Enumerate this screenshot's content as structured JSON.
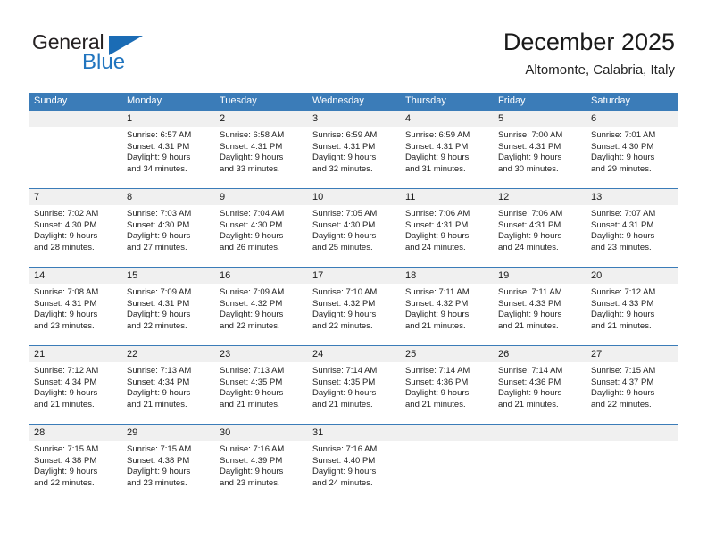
{
  "brand": {
    "name_part1": "General",
    "name_part2": "Blue",
    "flag_icon": "blue-triangle-flag",
    "accent_color": "#2175bf"
  },
  "header": {
    "title": "December 2025",
    "subtitle": "Altomonte, Calabria, Italy"
  },
  "calendar": {
    "header_bg": "#3b7cb8",
    "daynum_bg": "#f0f0f0",
    "weekdays": [
      "Sunday",
      "Monday",
      "Tuesday",
      "Wednesday",
      "Thursday",
      "Friday",
      "Saturday"
    ],
    "weeks": [
      [
        {
          "day": "",
          "sunrise": "",
          "sunset": "",
          "daylight1": "",
          "daylight2": ""
        },
        {
          "day": "1",
          "sunrise": "Sunrise: 6:57 AM",
          "sunset": "Sunset: 4:31 PM",
          "daylight1": "Daylight: 9 hours",
          "daylight2": "and 34 minutes."
        },
        {
          "day": "2",
          "sunrise": "Sunrise: 6:58 AM",
          "sunset": "Sunset: 4:31 PM",
          "daylight1": "Daylight: 9 hours",
          "daylight2": "and 33 minutes."
        },
        {
          "day": "3",
          "sunrise": "Sunrise: 6:59 AM",
          "sunset": "Sunset: 4:31 PM",
          "daylight1": "Daylight: 9 hours",
          "daylight2": "and 32 minutes."
        },
        {
          "day": "4",
          "sunrise": "Sunrise: 6:59 AM",
          "sunset": "Sunset: 4:31 PM",
          "daylight1": "Daylight: 9 hours",
          "daylight2": "and 31 minutes."
        },
        {
          "day": "5",
          "sunrise": "Sunrise: 7:00 AM",
          "sunset": "Sunset: 4:31 PM",
          "daylight1": "Daylight: 9 hours",
          "daylight2": "and 30 minutes."
        },
        {
          "day": "6",
          "sunrise": "Sunrise: 7:01 AM",
          "sunset": "Sunset: 4:30 PM",
          "daylight1": "Daylight: 9 hours",
          "daylight2": "and 29 minutes."
        }
      ],
      [
        {
          "day": "7",
          "sunrise": "Sunrise: 7:02 AM",
          "sunset": "Sunset: 4:30 PM",
          "daylight1": "Daylight: 9 hours",
          "daylight2": "and 28 minutes."
        },
        {
          "day": "8",
          "sunrise": "Sunrise: 7:03 AM",
          "sunset": "Sunset: 4:30 PM",
          "daylight1": "Daylight: 9 hours",
          "daylight2": "and 27 minutes."
        },
        {
          "day": "9",
          "sunrise": "Sunrise: 7:04 AM",
          "sunset": "Sunset: 4:30 PM",
          "daylight1": "Daylight: 9 hours",
          "daylight2": "and 26 minutes."
        },
        {
          "day": "10",
          "sunrise": "Sunrise: 7:05 AM",
          "sunset": "Sunset: 4:30 PM",
          "daylight1": "Daylight: 9 hours",
          "daylight2": "and 25 minutes."
        },
        {
          "day": "11",
          "sunrise": "Sunrise: 7:06 AM",
          "sunset": "Sunset: 4:31 PM",
          "daylight1": "Daylight: 9 hours",
          "daylight2": "and 24 minutes."
        },
        {
          "day": "12",
          "sunrise": "Sunrise: 7:06 AM",
          "sunset": "Sunset: 4:31 PM",
          "daylight1": "Daylight: 9 hours",
          "daylight2": "and 24 minutes."
        },
        {
          "day": "13",
          "sunrise": "Sunrise: 7:07 AM",
          "sunset": "Sunset: 4:31 PM",
          "daylight1": "Daylight: 9 hours",
          "daylight2": "and 23 minutes."
        }
      ],
      [
        {
          "day": "14",
          "sunrise": "Sunrise: 7:08 AM",
          "sunset": "Sunset: 4:31 PM",
          "daylight1": "Daylight: 9 hours",
          "daylight2": "and 23 minutes."
        },
        {
          "day": "15",
          "sunrise": "Sunrise: 7:09 AM",
          "sunset": "Sunset: 4:31 PM",
          "daylight1": "Daylight: 9 hours",
          "daylight2": "and 22 minutes."
        },
        {
          "day": "16",
          "sunrise": "Sunrise: 7:09 AM",
          "sunset": "Sunset: 4:32 PM",
          "daylight1": "Daylight: 9 hours",
          "daylight2": "and 22 minutes."
        },
        {
          "day": "17",
          "sunrise": "Sunrise: 7:10 AM",
          "sunset": "Sunset: 4:32 PM",
          "daylight1": "Daylight: 9 hours",
          "daylight2": "and 22 minutes."
        },
        {
          "day": "18",
          "sunrise": "Sunrise: 7:11 AM",
          "sunset": "Sunset: 4:32 PM",
          "daylight1": "Daylight: 9 hours",
          "daylight2": "and 21 minutes."
        },
        {
          "day": "19",
          "sunrise": "Sunrise: 7:11 AM",
          "sunset": "Sunset: 4:33 PM",
          "daylight1": "Daylight: 9 hours",
          "daylight2": "and 21 minutes."
        },
        {
          "day": "20",
          "sunrise": "Sunrise: 7:12 AM",
          "sunset": "Sunset: 4:33 PM",
          "daylight1": "Daylight: 9 hours",
          "daylight2": "and 21 minutes."
        }
      ],
      [
        {
          "day": "21",
          "sunrise": "Sunrise: 7:12 AM",
          "sunset": "Sunset: 4:34 PM",
          "daylight1": "Daylight: 9 hours",
          "daylight2": "and 21 minutes."
        },
        {
          "day": "22",
          "sunrise": "Sunrise: 7:13 AM",
          "sunset": "Sunset: 4:34 PM",
          "daylight1": "Daylight: 9 hours",
          "daylight2": "and 21 minutes."
        },
        {
          "day": "23",
          "sunrise": "Sunrise: 7:13 AM",
          "sunset": "Sunset: 4:35 PM",
          "daylight1": "Daylight: 9 hours",
          "daylight2": "and 21 minutes."
        },
        {
          "day": "24",
          "sunrise": "Sunrise: 7:14 AM",
          "sunset": "Sunset: 4:35 PM",
          "daylight1": "Daylight: 9 hours",
          "daylight2": "and 21 minutes."
        },
        {
          "day": "25",
          "sunrise": "Sunrise: 7:14 AM",
          "sunset": "Sunset: 4:36 PM",
          "daylight1": "Daylight: 9 hours",
          "daylight2": "and 21 minutes."
        },
        {
          "day": "26",
          "sunrise": "Sunrise: 7:14 AM",
          "sunset": "Sunset: 4:36 PM",
          "daylight1": "Daylight: 9 hours",
          "daylight2": "and 21 minutes."
        },
        {
          "day": "27",
          "sunrise": "Sunrise: 7:15 AM",
          "sunset": "Sunset: 4:37 PM",
          "daylight1": "Daylight: 9 hours",
          "daylight2": "and 22 minutes."
        }
      ],
      [
        {
          "day": "28",
          "sunrise": "Sunrise: 7:15 AM",
          "sunset": "Sunset: 4:38 PM",
          "daylight1": "Daylight: 9 hours",
          "daylight2": "and 22 minutes."
        },
        {
          "day": "29",
          "sunrise": "Sunrise: 7:15 AM",
          "sunset": "Sunset: 4:38 PM",
          "daylight1": "Daylight: 9 hours",
          "daylight2": "and 23 minutes."
        },
        {
          "day": "30",
          "sunrise": "Sunrise: 7:16 AM",
          "sunset": "Sunset: 4:39 PM",
          "daylight1": "Daylight: 9 hours",
          "daylight2": "and 23 minutes."
        },
        {
          "day": "31",
          "sunrise": "Sunrise: 7:16 AM",
          "sunset": "Sunset: 4:40 PM",
          "daylight1": "Daylight: 9 hours",
          "daylight2": "and 24 minutes."
        },
        {
          "day": "",
          "sunrise": "",
          "sunset": "",
          "daylight1": "",
          "daylight2": ""
        },
        {
          "day": "",
          "sunrise": "",
          "sunset": "",
          "daylight1": "",
          "daylight2": ""
        },
        {
          "day": "",
          "sunrise": "",
          "sunset": "",
          "daylight1": "",
          "daylight2": ""
        }
      ]
    ]
  }
}
